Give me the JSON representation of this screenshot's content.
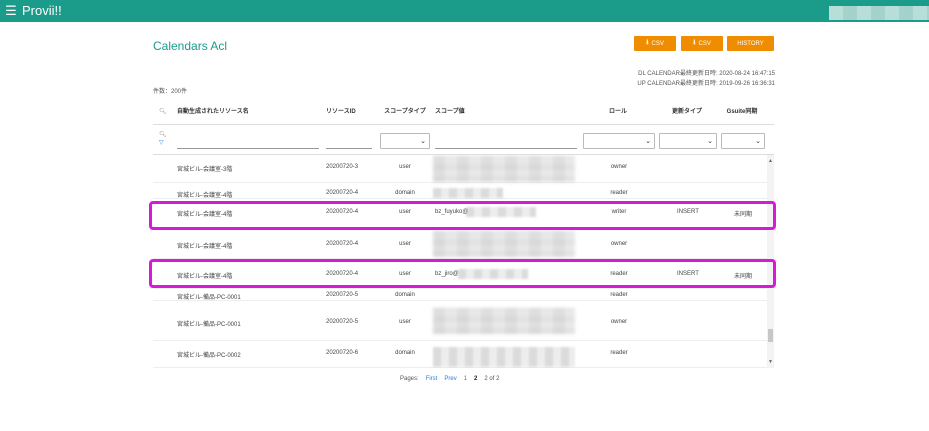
{
  "app": {
    "title": "Provii!!",
    "menu_icon": "hamburger-icon",
    "accent": "#1b9b8a"
  },
  "header": {
    "page_title": "Calendars Acl",
    "buttons": [
      {
        "label": "CSV",
        "icon": "download-icon"
      },
      {
        "label": "CSV",
        "icon": "download-icon"
      },
      {
        "label": "HISTORY"
      }
    ],
    "button_color": "#f08c00",
    "dl_info": "DL CALENDAR最終更新日時: 2020-08-24 16:47:15",
    "up_info": "UP CALENDAR最終更新日時: 2019-09-26 16:36:31",
    "record_count": "件数：200件"
  },
  "table": {
    "columns": [
      "自動生成されたリソース名",
      "リソースID",
      "スコープタイプ",
      "スコープ値",
      "ロール",
      "更新タイプ",
      "Gsuite同期"
    ],
    "rows": [
      {
        "name": "宮城ビル-会議室-3階",
        "id": "20200720-3",
        "scope_type": "user",
        "scope_value": "",
        "role": "owner",
        "update_type": "",
        "sync": ""
      },
      {
        "name": "宮城ビル-会議室-4階",
        "id": "20200720-4",
        "scope_type": "domain",
        "scope_value": "",
        "role": "reader",
        "update_type": "",
        "sync": ""
      },
      {
        "name": "宮城ビル-会議室-4階",
        "id": "20200720-4",
        "scope_type": "user",
        "scope_value": "bz_fuyuko@",
        "role": "writer",
        "update_type": "INSERT",
        "sync": "未同期"
      },
      {
        "name": "宮城ビル-会議室-4階",
        "id": "20200720-4",
        "scope_type": "user",
        "scope_value": "",
        "role": "owner",
        "update_type": "",
        "sync": ""
      },
      {
        "name": "宮城ビル-会議室-4階",
        "id": "20200720-4",
        "scope_type": "user",
        "scope_value": "bz_jiro@",
        "role": "reader",
        "update_type": "INSERT",
        "sync": "未同期"
      },
      {
        "name": "宮城ビル-備品-PC-0001",
        "id": "20200720-5",
        "scope_type": "domain",
        "scope_value": "",
        "role": "reader",
        "update_type": "",
        "sync": ""
      },
      {
        "name": "宮城ビル-備品-PC-0001",
        "id": "20200720-5",
        "scope_type": "user",
        "scope_value": "",
        "role": "owner",
        "update_type": "",
        "sync": ""
      },
      {
        "name": "宮城ビル-備品-PC-0002",
        "id": "20200720-6",
        "scope_type": "domain",
        "scope_value": "",
        "role": "reader",
        "update_type": "",
        "sync": ""
      }
    ]
  },
  "pager": {
    "label": "Pages:",
    "first": "First",
    "prev": "Prev",
    "page1": "1",
    "page2": "2",
    "summary": "2 of 2"
  },
  "highlight_color": "#d61ad6"
}
